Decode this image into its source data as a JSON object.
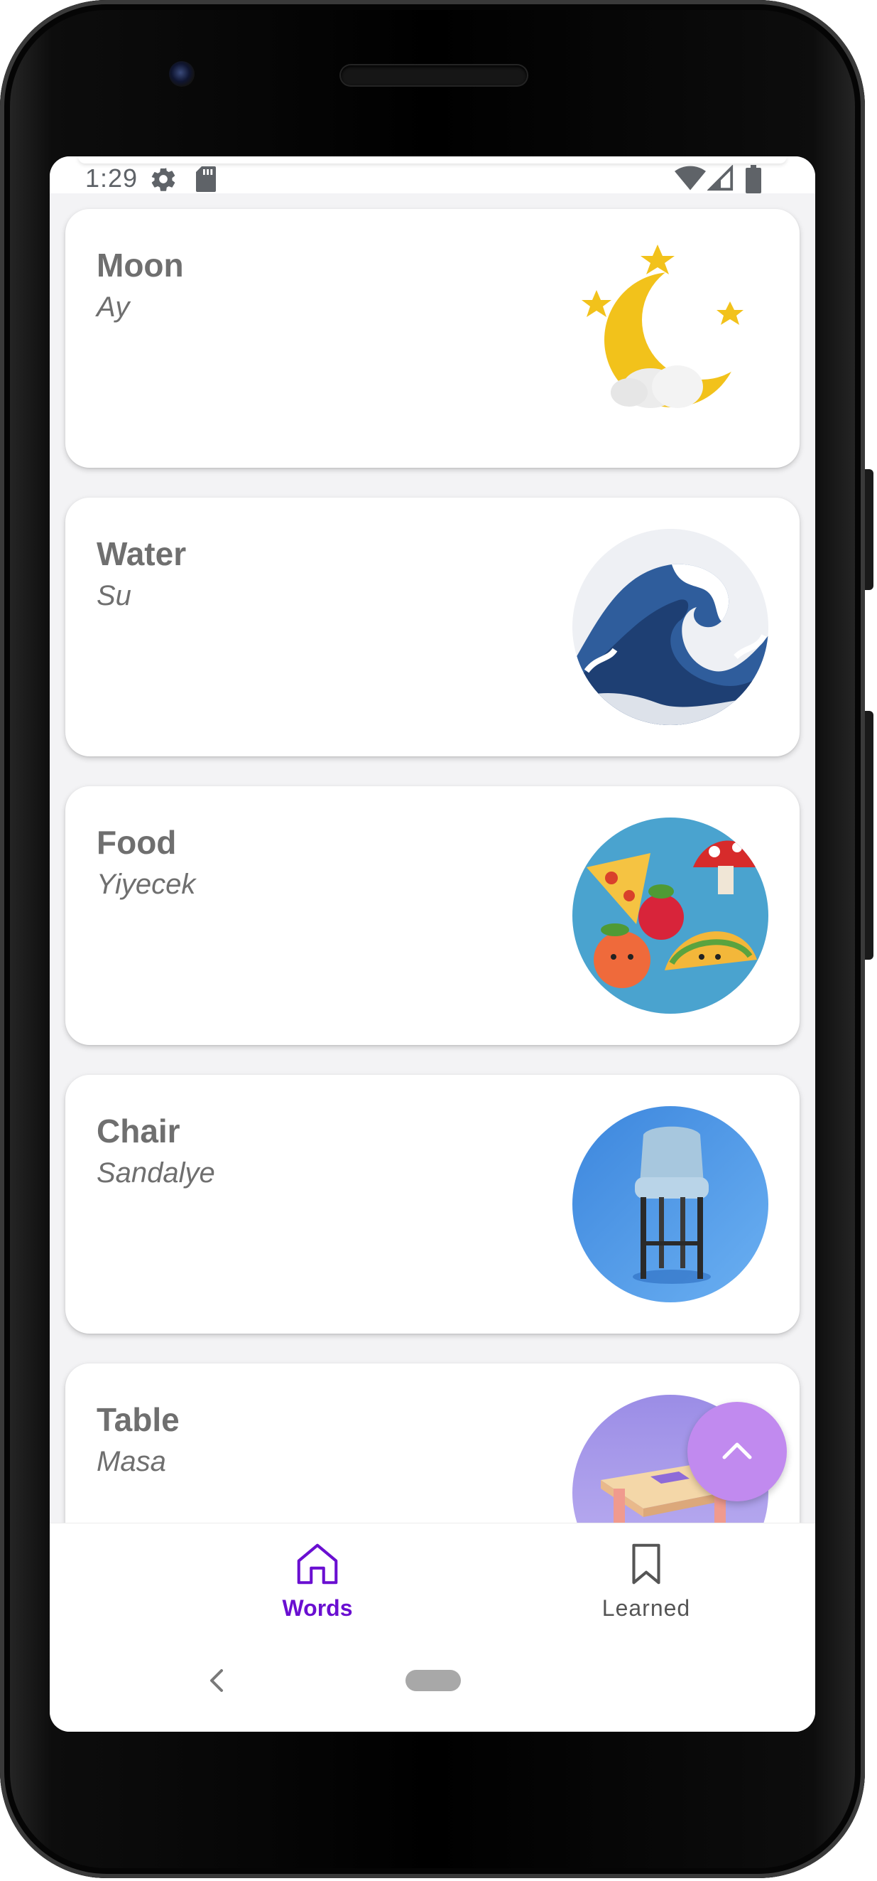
{
  "status_bar": {
    "time": "1:29",
    "icons": [
      "gear-icon",
      "sd-card-icon",
      "wifi-icon",
      "signal-icon",
      "battery-icon"
    ]
  },
  "words": [
    {
      "word": "Moon",
      "translation": "Ay",
      "image": "moon-image"
    },
    {
      "word": "Water",
      "translation": "Su",
      "image": "wave-image"
    },
    {
      "word": "Food",
      "translation": "Yiyecek",
      "image": "food-image"
    },
    {
      "word": "Chair",
      "translation": "Sandalye",
      "image": "chair-image"
    },
    {
      "word": "Table",
      "translation": "Masa",
      "image": "table-image"
    }
  ],
  "fab": {
    "icon": "chevron-up-icon"
  },
  "bottom_nav": {
    "items": [
      {
        "label": "Words",
        "icon": "home-icon",
        "active": true
      },
      {
        "label": "Learned",
        "icon": "bookmark-icon",
        "active": false
      }
    ]
  },
  "colors": {
    "accent": "#6a0fd1",
    "fab": "#c18aef",
    "text_muted": "#6f6f6f",
    "card_bg": "#ffffff"
  }
}
